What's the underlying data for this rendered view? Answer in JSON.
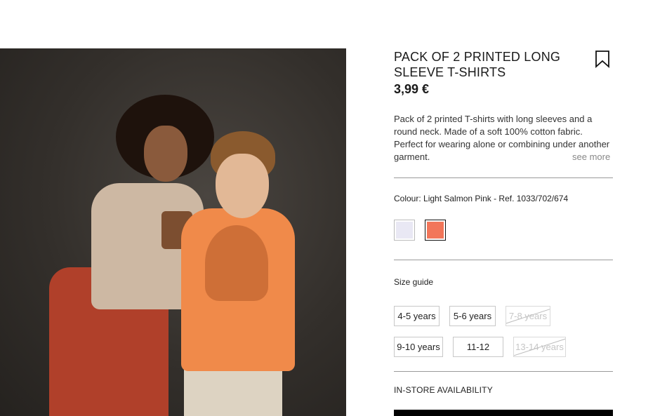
{
  "product": {
    "title": "PACK OF 2 PRINTED LONG SLEEVE T-SHIRTS",
    "price": "3,99 €",
    "description": "Pack of 2 printed T-shirts with long sleeves and a round neck. Made of a soft 100% cotton fabric. Perfect for wearing alone or combining under another garment.",
    "see_more": "see more"
  },
  "icons": {
    "bookmark": "bookmark-icon"
  },
  "colour": {
    "label": "Colour: Light Salmon Pink - Ref. 1033/702/674",
    "swatches": [
      {
        "name": "white",
        "color": "#e9e8f4",
        "selected": false
      },
      {
        "name": "light-salmon-pink",
        "color": "#f2765a",
        "selected": true
      }
    ]
  },
  "sizes": {
    "guide_label": "Size guide",
    "items": [
      {
        "label": "4-5 years",
        "available": true
      },
      {
        "label": "5-6 years",
        "available": true
      },
      {
        "label": "7-8 years",
        "available": false
      },
      {
        "label": "9-10 years",
        "available": true
      },
      {
        "label": "11-12 years",
        "available": true
      },
      {
        "label": "13-14 years",
        "available": false
      }
    ]
  },
  "availability": {
    "label": "IN-STORE AVAILABILITY"
  },
  "colors": {
    "text": "#1a1a1a",
    "muted": "#888888",
    "cta": "#000000"
  }
}
